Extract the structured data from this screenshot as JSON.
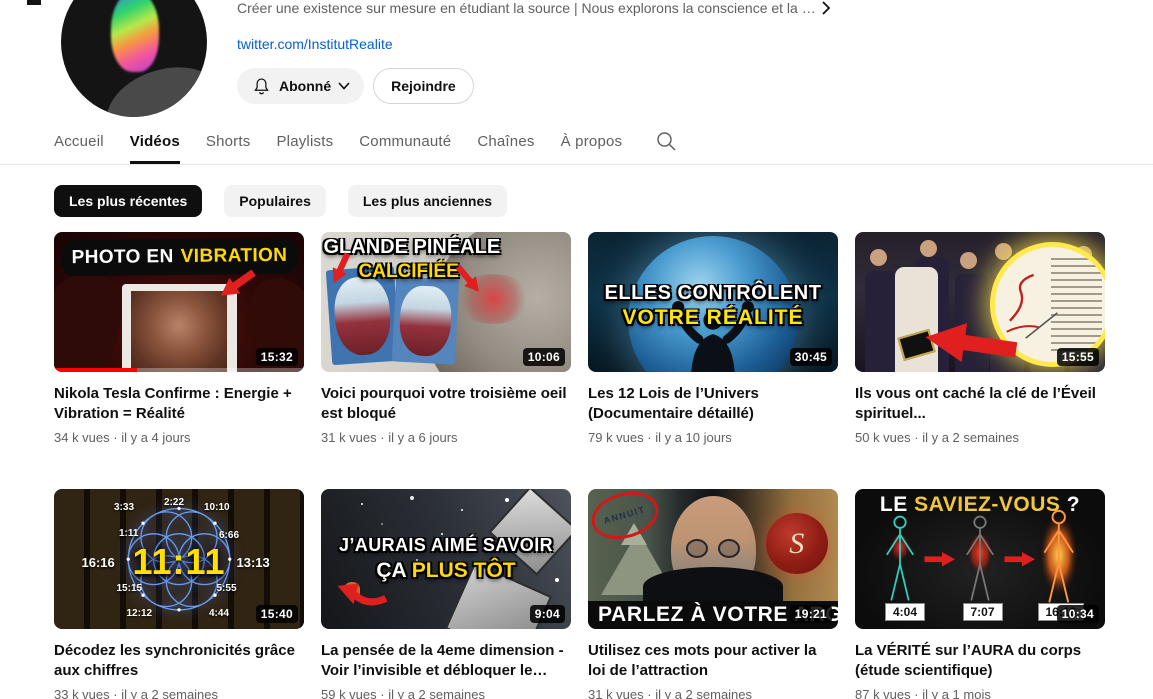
{
  "colors": {
    "link_blue": "#065fd4",
    "active_chip_bg": "#0f0f0f",
    "watched_progress_red": "#ff0000",
    "thumb_accent_yellow": "#ffd903",
    "arrow_red": "#e01f1f"
  },
  "icons": {
    "description_more": "chevron-right-icon",
    "subscribed_bell": "bell-icon",
    "subscribed_caret": "chevron-down-icon",
    "tabs_search": "search-icon"
  },
  "header": {
    "description": "Créer une existence sur mesure en étudiant la source | Nous explorons la conscience et la …",
    "link": "twitter.com/InstitutRealite",
    "subscribed_label": "Abonné",
    "join_label": "Rejoindre"
  },
  "tabs": {
    "active": "Vidéos",
    "items": [
      {
        "label": "Accueil"
      },
      {
        "label": "Vidéos"
      },
      {
        "label": "Shorts"
      },
      {
        "label": "Playlists"
      },
      {
        "label": "Communauté"
      },
      {
        "label": "Chaînes"
      },
      {
        "label": "À propos"
      }
    ]
  },
  "filters": [
    {
      "label": "Les plus récentes",
      "active": true
    },
    {
      "label": "Populaires",
      "active": false
    },
    {
      "label": "Les plus anciennes",
      "active": false
    }
  ],
  "videos": [
    {
      "title": "Nikola Tesla Confirme : Energie + Vibration = Réalité",
      "meta": "34 k vues · il y a 4 jours",
      "duration": "15:32",
      "progress_percent": 33,
      "thumb": {
        "line1": "PHOTO EN",
        "line2": "VIBRATION"
      }
    },
    {
      "title": "Voici pourquoi votre troisième oeil est bloqué",
      "meta": "31 k vues · il y a 6 jours",
      "duration": "10:06",
      "thumb": {
        "line1": "GLANDE PINÉALE",
        "line2": "CALCIFIÉE"
      }
    },
    {
      "title": "Les 12 Lois de l’Univers (Documentaire détaillé)",
      "meta": "79 k vues · il y a 10 jours",
      "duration": "30:45",
      "thumb": {
        "line1": "ELLES CONTRÔLENT",
        "line2": "VOTRE RÉALITÉ"
      }
    },
    {
      "title": "Ils vous ont caché la clé de l’Éveil spirituel...",
      "meta": "50 k vues · il y a 2 semaines",
      "duration": "15:55",
      "thumb": {}
    },
    {
      "title": "Décodez les synchronicités grâce aux chiffres",
      "meta": "33 k vues · il y a 2 semaines",
      "duration": "15:40",
      "thumb": {
        "center": "11:11",
        "times": [
          "3:33",
          "2:22",
          "10:10",
          "1:11",
          "6:66",
          "16:16",
          "13:13",
          "15:15",
          "5:55",
          "12:12",
          "4:44"
        ]
      }
    },
    {
      "title": "La pensée de la 4eme dimension - Voir l’invisible et débloquer le…",
      "meta": "59 k vues · il y a 2 semaines",
      "duration": "9:04",
      "thumb": {
        "line1": "J’AURAIS AIMÉ SAVOIR",
        "line2a": "ÇA",
        "line2b": "PLUS TÔT"
      }
    },
    {
      "title": "Utilisez ces mots pour activer la loi de l’attraction",
      "meta": "31 k vues · il y a 2 semaines",
      "duration": "19:21",
      "thumb": {
        "banner": "PARLEZ À VOTRE ARG",
        "annuit": "ANNUIT",
        "seal": "S"
      }
    },
    {
      "title": "La VÉRITÉ sur l’AURA du corps (étude scientifique)",
      "meta": "87 k vues · il y a 1 mois",
      "duration": "10:34",
      "thumb": {
        "word1": "LE",
        "word2": "SAVIEZ-VOUS",
        "word3": "?",
        "times": [
          "4:04",
          "7:07",
          "16:16"
        ]
      }
    }
  ]
}
